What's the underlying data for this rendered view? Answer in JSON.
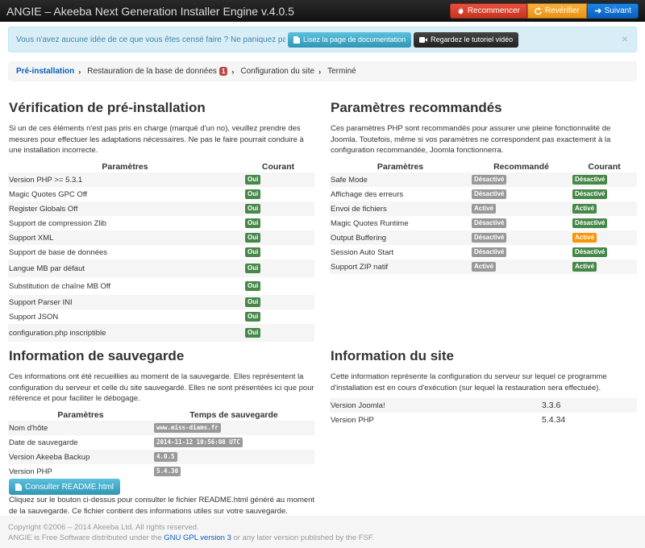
{
  "header": {
    "title": "ANGIE – Akeeba Next Generation Installer Engine v.4.0.5",
    "buttons": [
      {
        "label": "Recommencer",
        "icon": "fire-icon"
      },
      {
        "label": "Revérifier",
        "icon": "refresh-icon"
      },
      {
        "label": "Suivant",
        "icon": "arrow-right-icon"
      }
    ]
  },
  "alert": {
    "text": "Vous n'avez aucune idée de ce que vous êtes censé faire ? Ne paniquez pas !",
    "doc_button": "Lisez la page de documentation",
    "video_button": "Regardez le tutoriel vidéo",
    "close": "×"
  },
  "breadcrumb": {
    "items": [
      "Pré-installation",
      "Restauration de la base de données",
      "Configuration du site",
      "Terminé"
    ],
    "badge": "1"
  },
  "preinstall": {
    "title": "Vérification de pré-installation",
    "description": "Si un de ces éléments n'est pas pris en charge (marqué d'un no), veuillez prendre des mesures pour effectuer les adaptations nécessaires. Ne pas le faire pourrait conduire à une installation incorrecte.",
    "col_param": "Paramètres",
    "col_current": "Courant",
    "rows": [
      {
        "name": "Version PHP >= 5.3.1",
        "current": "Oui"
      },
      {
        "name": "Magic Quotes GPC Off",
        "current": "Oui"
      },
      {
        "name": "Register Globals Off",
        "current": "Oui"
      },
      {
        "name": "Support de compression Zlib",
        "current": "Oui"
      },
      {
        "name": "Support XML",
        "current": "Oui"
      },
      {
        "name": "Support de base de données",
        "current": "Oui"
      },
      {
        "name": "Langue MB par défaut",
        "current": "Oui"
      },
      {
        "name": "Substitution de chaîne MB Off",
        "current": "Oui"
      },
      {
        "name": "Support Parser INI",
        "current": "Oui"
      },
      {
        "name": "Support JSON",
        "current": "Oui"
      },
      {
        "name": "configuration.php inscriptible",
        "current": "Oui"
      }
    ]
  },
  "recommended": {
    "title": "Paramètres recommandés",
    "description": "Ces paramètres PHP sont recommandés pour assurer une pleine fonctionnalité de Joomla. Toutefois, même si vos paramètres ne correspondent pas exactement à la configuration recommandée, Joomla fonctionnerra.",
    "col_param": "Paramètres",
    "col_recommended": "Recommandé",
    "col_current": "Courant",
    "rows": [
      {
        "name": "Safe Mode",
        "recommended": "Désactivé",
        "current": "Désactivé",
        "status": "ok"
      },
      {
        "name": "Affichage des erreurs",
        "recommended": "Désactivé",
        "current": "Désactivé",
        "status": "ok"
      },
      {
        "name": "Envoi de fichiers",
        "recommended": "Activé",
        "current": "Activé",
        "status": "ok"
      },
      {
        "name": "Magic Quotes Runtime",
        "recommended": "Désactivé",
        "current": "Désactivé",
        "status": "ok"
      },
      {
        "name": "Output Buffering",
        "recommended": "Désactivé",
        "current": "Activé",
        "status": "warn"
      },
      {
        "name": "Session Auto Start",
        "recommended": "Désactivé",
        "current": "Désactivé",
        "status": "ok"
      },
      {
        "name": "Support ZIP natif",
        "recommended": "Activé",
        "current": "Activé",
        "status": "ok"
      }
    ]
  },
  "backup": {
    "title": "Information de sauvegarde",
    "description": "Ces informations ont été recueillies au moment de la sauvegarde. Elles représentent la configuration du serveur et celle du site sauvegardé. Elles ne sont présentées ici que pour référence et pour faciliter le débogage.",
    "col_param": "Paramètres",
    "col_time": "Temps de sauvegarde",
    "rows": [
      {
        "name": "Nom d'hôte",
        "value": "www.miss-diams.fr"
      },
      {
        "name": "Date de sauvegarde",
        "value": "2014-11-12 10:56:08 UTC"
      },
      {
        "name": "Version Akeeba Backup",
        "value": "4.0.5"
      },
      {
        "name": "Version PHP",
        "value": "5.4.30"
      }
    ],
    "readme_button": "Consulter README.html",
    "readme_note": "Cliquez sur le bouton ci-dessus pour consulter le fichier README.html généré au moment de la sauvegarde. Ce fichier contient des informations utiles sur votre sauvegarde."
  },
  "site": {
    "title": "Information du site",
    "description": "Cette information représente la configuration du serveur sur lequel ce programme d'installation est en cours d'exécution (sur lequel la restauration sera effectuée).",
    "rows": [
      {
        "name": "Version Joomla!",
        "value": "3.3.6"
      },
      {
        "name": "Version PHP",
        "value": "5.4.34"
      }
    ]
  },
  "footer": {
    "copyright": "Copyright ©2006 – 2014 Akeeba Ltd. All rights reserved.",
    "license_prefix": "ANGIE is Free Software distributed under the",
    "license_link": "GNU GPL version 3",
    "license_suffix": "or any later version published by the FSF."
  }
}
